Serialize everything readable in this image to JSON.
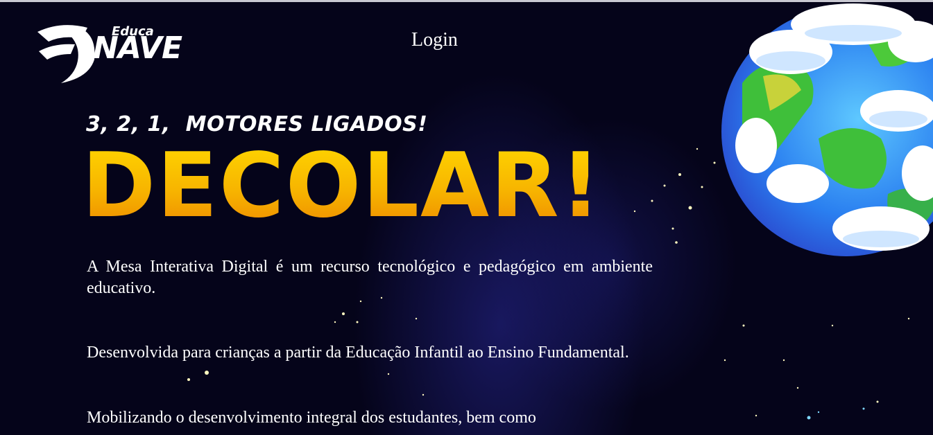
{
  "header": {
    "logo_top_text": "Educa",
    "logo_main_text": "NAVE",
    "login_label": "Login"
  },
  "hero": {
    "tagline": "3, 2, 1,  MOTORES LIGADOS!",
    "headline": "DECOLAR!",
    "paragraphs": [
      "A Mesa Interativa Digital é um recurso tecnológico e pedagógico em ambiente educativo.",
      "Desenvolvida para crianças a partir da Educação Infantil ao Ensino Fundamental.",
      "Mobilizando o desenvolvimento integral dos estudantes, bem como"
    ]
  },
  "colors": {
    "background": "#05041a",
    "headline_top": "#ffd500",
    "headline_bottom": "#ee8b00",
    "text": "#ffffff"
  },
  "icons": {
    "logo": "rocket-star-logo",
    "decoration": "earth-planet-illustration"
  }
}
